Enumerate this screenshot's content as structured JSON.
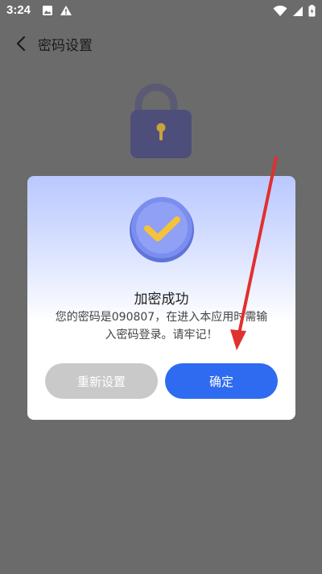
{
  "status_bar": {
    "time": "3:24",
    "left_icons": [
      "image-icon",
      "warning-icon"
    ],
    "right_icons": [
      "wifi-icon",
      "signal-icon",
      "battery-icon"
    ]
  },
  "header": {
    "title": "密码设置",
    "back_icon": "chevron-left-icon"
  },
  "dialog": {
    "title": "加密成功",
    "message_line1": "您的密码是090807，在进入本应用时需输",
    "message_line2": "入密码登录。请牢记！",
    "reset_label": "重新设置",
    "confirm_label": "确定"
  },
  "colors": {
    "background": "#6b6b6b",
    "primary": "#2f6bf0",
    "secondary_button": "#c9c9c9",
    "lock_body": "#5a5a85",
    "check_yellow": "#f5c23a",
    "arrow_red": "#e03030"
  }
}
